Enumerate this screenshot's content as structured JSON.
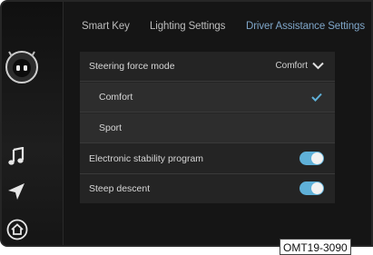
{
  "tabs": [
    {
      "label": "Smart Key",
      "active": false
    },
    {
      "label": "Lighting Settings",
      "active": false
    },
    {
      "label": "Driver Assistance Settings",
      "active": true
    }
  ],
  "settings": {
    "steering_mode": {
      "label": "Steering force mode",
      "value": "Comfort"
    },
    "options": [
      {
        "label": "Comfort",
        "selected": true
      },
      {
        "label": "Sport",
        "selected": false
      }
    ],
    "esp": {
      "label": "Electronic stability program",
      "on": true
    },
    "descent": {
      "label": "Steep descent",
      "on": true
    }
  },
  "sidebar": {
    "icons": [
      "robot-avatar-icon",
      "music-note-icon",
      "navigation-arrow-icon",
      "home-icon"
    ]
  },
  "caption": "OMT19-3090",
  "colors": {
    "accent": "#5fb0d8",
    "active_tab": "#7fa6c9",
    "panel": "#242424"
  }
}
